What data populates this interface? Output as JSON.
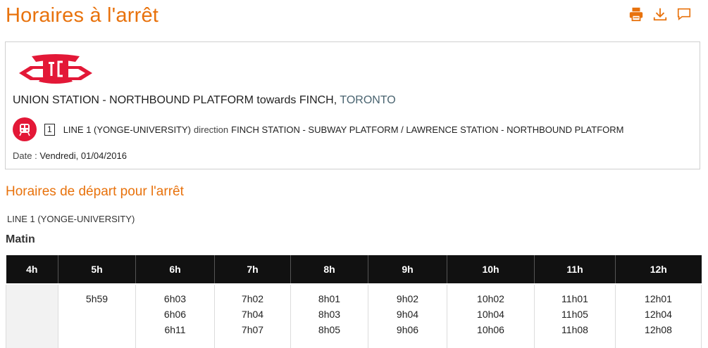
{
  "page": {
    "title": "Horaires à l'arrêt"
  },
  "toolbar": {
    "print_icon": "print-icon",
    "download_icon": "download-icon",
    "comment_icon": "comment-icon",
    "accent": "#e8720c"
  },
  "stop": {
    "name": "UNION STATION - NORTHBOUND PLATFORM towards FINCH,",
    "city": "TORONTO"
  },
  "route": {
    "number": "1",
    "line": "LINE 1 (YONGE-UNIVERSITY)",
    "direction_word": "direction",
    "direction": "FINCH STATION - SUBWAY PLATFORM / LAWRENCE STATION - NORTHBOUND PLATFORM",
    "badge_color": "#e31837"
  },
  "date": {
    "label": "Date :",
    "value": "Vendredi, 01/04/2016"
  },
  "schedule": {
    "section_title": "Horaires de départ pour l'arrêt",
    "line_name": "LINE 1 (YONGE-UNIVERSITY)",
    "period": "Matin",
    "hours": [
      "4h",
      "5h",
      "6h",
      "7h",
      "8h",
      "9h",
      "10h",
      "11h",
      "12h"
    ],
    "times": [
      [],
      [
        "5h59"
      ],
      [
        "6h03",
        "6h06",
        "6h11"
      ],
      [
        "7h02",
        "7h04",
        "7h07"
      ],
      [
        "8h01",
        "8h03",
        "8h05"
      ],
      [
        "9h02",
        "9h04",
        "9h06"
      ],
      [
        "10h02",
        "10h04",
        "10h06"
      ],
      [
        "11h01",
        "11h05",
        "11h08"
      ],
      [
        "12h01",
        "12h04",
        "12h08"
      ]
    ]
  }
}
